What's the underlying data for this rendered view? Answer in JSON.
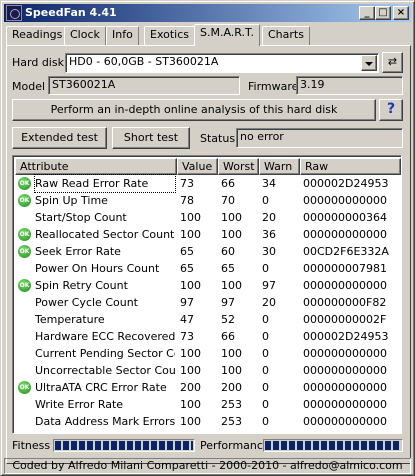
{
  "window": {
    "title": "SpeedFan 4.41"
  },
  "tabs": [
    {
      "label": "Readings"
    },
    {
      "label": "Clock"
    },
    {
      "label": "Info"
    },
    {
      "label": "Exotics"
    },
    {
      "label": "S.M.A.R.T."
    },
    {
      "label": "Charts"
    }
  ],
  "active_tab": "S.M.A.R.T.",
  "disk": {
    "hard_disk_label": "Hard disk",
    "hard_disk_value": "HD0 - 60,0GB - ST360021A",
    "model_label": "Model",
    "model_value": "ST360021A",
    "firmware_label": "Firmware",
    "firmware_value": "3.19"
  },
  "actions": {
    "analysis_button": "Perform an in-depth online analysis of this hard disk",
    "help_button": "?",
    "extended_test_button": "Extended test",
    "short_test_button": "Short test",
    "status_label": "Status",
    "status_value": "no error"
  },
  "table": {
    "columns": [
      "Attribute",
      "Value",
      "Worst",
      "Warn",
      "Raw"
    ],
    "rows": [
      {
        "ok": true,
        "attribute": "Raw Read Error Rate",
        "value": "73",
        "worst": "66",
        "warn": "34",
        "raw": "000002D24953"
      },
      {
        "ok": true,
        "attribute": "Spin Up Time",
        "value": "78",
        "worst": "70",
        "warn": "0",
        "raw": "000000000000"
      },
      {
        "ok": false,
        "attribute": "Start/Stop Count",
        "value": "100",
        "worst": "100",
        "warn": "20",
        "raw": "000000000364"
      },
      {
        "ok": true,
        "attribute": "Reallocated Sector Count",
        "value": "100",
        "worst": "100",
        "warn": "36",
        "raw": "000000000000"
      },
      {
        "ok": true,
        "attribute": "Seek Error Rate",
        "value": "65",
        "worst": "60",
        "warn": "30",
        "raw": "00CD2F6E332A"
      },
      {
        "ok": false,
        "attribute": "Power On Hours Count",
        "value": "65",
        "worst": "65",
        "warn": "0",
        "raw": "000000007981"
      },
      {
        "ok": true,
        "attribute": "Spin Retry Count",
        "value": "100",
        "worst": "100",
        "warn": "97",
        "raw": "000000000000"
      },
      {
        "ok": false,
        "attribute": "Power Cycle Count",
        "value": "97",
        "worst": "97",
        "warn": "20",
        "raw": "000000000F82"
      },
      {
        "ok": false,
        "attribute": "Temperature",
        "value": "47",
        "worst": "52",
        "warn": "0",
        "raw": "00000000002F"
      },
      {
        "ok": false,
        "attribute": "Hardware ECC Recovered",
        "value": "73",
        "worst": "66",
        "warn": "0",
        "raw": "000002D24953"
      },
      {
        "ok": false,
        "attribute": "Current Pending Sector Co...",
        "value": "100",
        "worst": "100",
        "warn": "0",
        "raw": "000000000000"
      },
      {
        "ok": false,
        "attribute": "Uncorrectable Sector Count",
        "value": "100",
        "worst": "100",
        "warn": "0",
        "raw": "000000000000"
      },
      {
        "ok": true,
        "attribute": "UltraATA CRC Error Rate",
        "value": "200",
        "worst": "200",
        "warn": "0",
        "raw": "000000000000"
      },
      {
        "ok": false,
        "attribute": "Write Error Rate",
        "value": "100",
        "worst": "253",
        "warn": "0",
        "raw": "000000000000"
      },
      {
        "ok": false,
        "attribute": "Data Address Mark Errors",
        "value": "100",
        "worst": "253",
        "warn": "0",
        "raw": "000000000000"
      }
    ]
  },
  "indicators": {
    "fitness_label": "Fitness",
    "fitness_level": 1.0,
    "performance_label": "Performance",
    "performance_level": 1.0
  },
  "ok_icon_text": "OK",
  "statusbar": {
    "text": "Coded by Alfredo Milani Comparetti - 2000-2010 - alfredo@almico.com"
  },
  "colors": {
    "titlebar_start": "#0a246a",
    "titlebar_end": "#a6caf0",
    "bar_fill": "#0a246a",
    "ok_green": "#1a8a1a"
  }
}
